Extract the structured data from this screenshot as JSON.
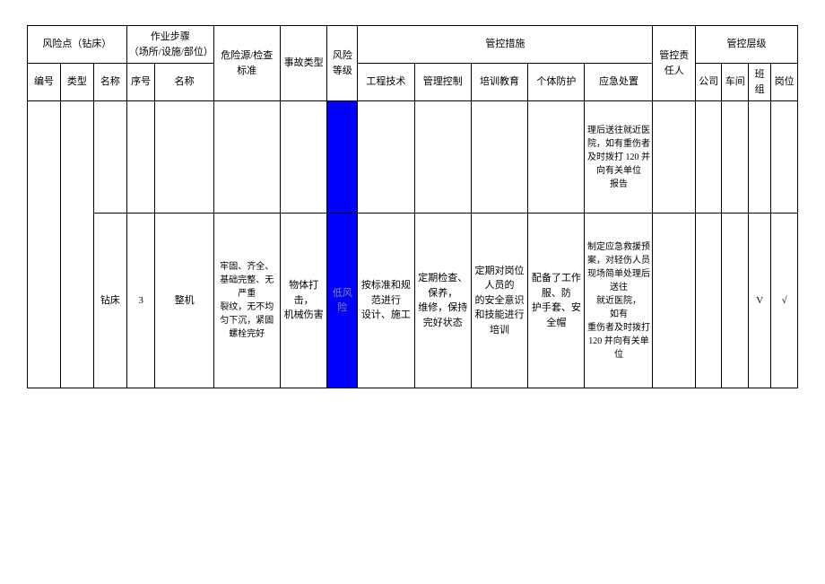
{
  "header": {
    "risk_point_group": "风险点（钻床）",
    "work_step_group": "作业步骤\n（场所/设施/部位）",
    "hazard_check": "危险源/检查标准",
    "accident_type": "事故类型",
    "risk_level": "风险等级",
    "control_measures": "管控措施",
    "responsible": "管控责任人",
    "control_level": "管控层级",
    "sub": {
      "number": "编号",
      "type": "类型",
      "name": "名称",
      "seq": "序号",
      "step_name": "名称",
      "eng_tech": "工程技术",
      "mgmt_ctrl": "管理控制",
      "training": "培训教育",
      "ppe": "个体防护",
      "emergency": "应急处置",
      "company": "公司",
      "workshop": "车间",
      "team": "班组",
      "post": "岗位"
    }
  },
  "rows": [
    {
      "risk_level": "",
      "emergency": "理后送往就近医院，如有重伤者及时拨打 120 并向有关单位\n报告"
    },
    {
      "name": "钻床",
      "seq": "3",
      "step_name": "整机",
      "hazard": "牢固、齐全、基础完整、无严重\n裂纹，无不均匀下沉，紧固螺栓完好",
      "accident": "物体打击，\n机械伤害",
      "risk_level": "低风险",
      "eng_tech": "按标准和规范进行\n设计、施工",
      "mgmt_ctrl": "定期检查、保养，\n维修，保持完好状态",
      "training": "定期对岗位人员的\n的安全意识和技能进行培训",
      "ppe": "配备了工作服、防\n护手套、安全帽",
      "emergency": "制定应急救援预\n案，对轻伤人员现场简单处理后送往\n就近医院，\n如有\n重伤者及时拨打 120 并向有关单位",
      "team": "V",
      "post": "√"
    }
  ]
}
